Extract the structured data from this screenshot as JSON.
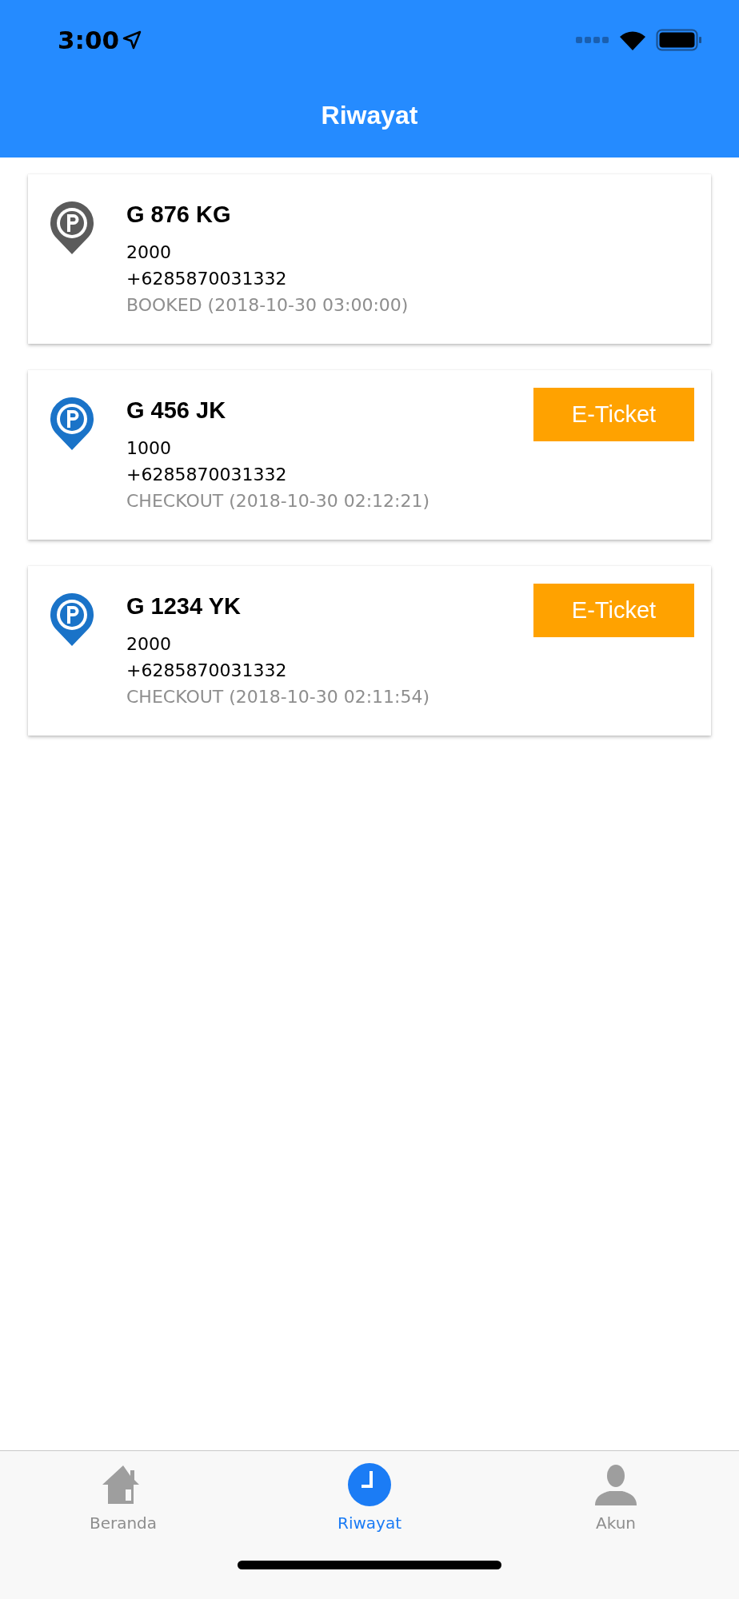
{
  "status_bar": {
    "time": "3:00"
  },
  "header": {
    "title": "Riwayat"
  },
  "history": [
    {
      "kind": "booked",
      "plate": "G 876 KG",
      "amount": "2000",
      "phone": "+6285870031332",
      "status": "BOOKED (2018-10-30 03:00:00)"
    },
    {
      "kind": "checkout",
      "plate": "G 456 JK",
      "amount": "1000",
      "phone": "+6285870031332",
      "status": "CHECKOUT (2018-10-30 02:12:21)",
      "button": "E-Ticket"
    },
    {
      "kind": "checkout",
      "plate": "G 1234 YK",
      "amount": "2000",
      "phone": "+6285870031332",
      "status": "CHECKOUT (2018-10-30 02:11:54)",
      "button": "E-Ticket"
    }
  ],
  "tabs": [
    {
      "kind": "home",
      "label": "Beranda",
      "selected": false
    },
    {
      "kind": "clock",
      "label": "Riwayat",
      "selected": true
    },
    {
      "kind": "person",
      "label": "Akun",
      "selected": false
    }
  ]
}
